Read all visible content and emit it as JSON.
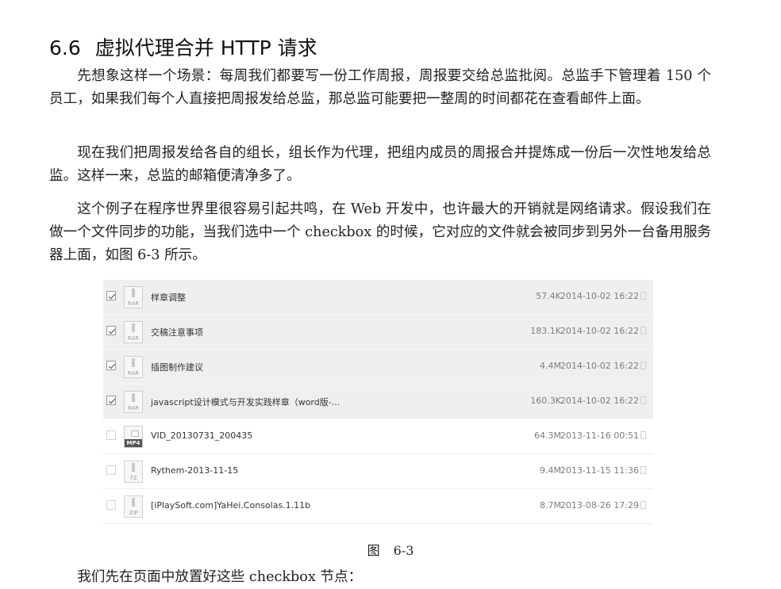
{
  "section": {
    "number": "6.6",
    "title": "虚拟代理合并 HTTP 请求"
  },
  "paragraphs": [
    "先想象这样一个场景：每周我们都要写一份工作周报，周报要交给总监批阅。总监手下管理着 150 个员工，如果我们每个人直接把周报发给总监，那总监可能要把一整周的时间都花在查看邮件上面。",
    "现在我们把周报发给各自的组长，组长作为代理，把组内成员的周报合并提炼成一份后一次性地发给总监。这样一来，总监的邮箱便清净多了。",
    "这个例子在程序世界里很容易引起共鸣，在 Web 开发中，也许最大的开销就是网络请求。假设我们在做一个文件同步的功能，当我们选中一个 checkbox 的时候，它对应的文件就会被同步到另外一台备用服务器上面，如图 6-3 所示。",
    "我们先在页面中放置好这些 checkbox 节点："
  ],
  "files": [
    {
      "name": "样章调整",
      "type": "RAR",
      "size": "57.4K",
      "date": "2014-10-02 16:22",
      "checked": true
    },
    {
      "name": "交稿注意事项",
      "type": "RAR",
      "size": "183.1K",
      "date": "2014-10-02 16:22",
      "checked": true
    },
    {
      "name": "插图制作建议",
      "type": "RAR",
      "size": "4.4M",
      "date": "2014-10-02 16:22",
      "checked": true
    },
    {
      "name": "javascript设计模式与开发实践样章（word版-...",
      "type": "RAR",
      "size": "160.3K",
      "date": "2014-10-02 16:22",
      "checked": true
    },
    {
      "name": "VID_20130731_200435",
      "type": "MP4",
      "size": "64.3M",
      "date": "2013-11-16 00:51",
      "checked": false
    },
    {
      "name": "Rythem-2013-11-15",
      "type": "7Z",
      "size": "9.4M",
      "date": "2013-11-15 11:36",
      "checked": false
    },
    {
      "name": "[iPlaySoft.com]YaHei.Consolas.1.11b",
      "type": "ZIP",
      "size": "8.7M",
      "date": "2013-08-26 17:29",
      "checked": false
    }
  ],
  "figure": {
    "caption": "图 6-3"
  }
}
